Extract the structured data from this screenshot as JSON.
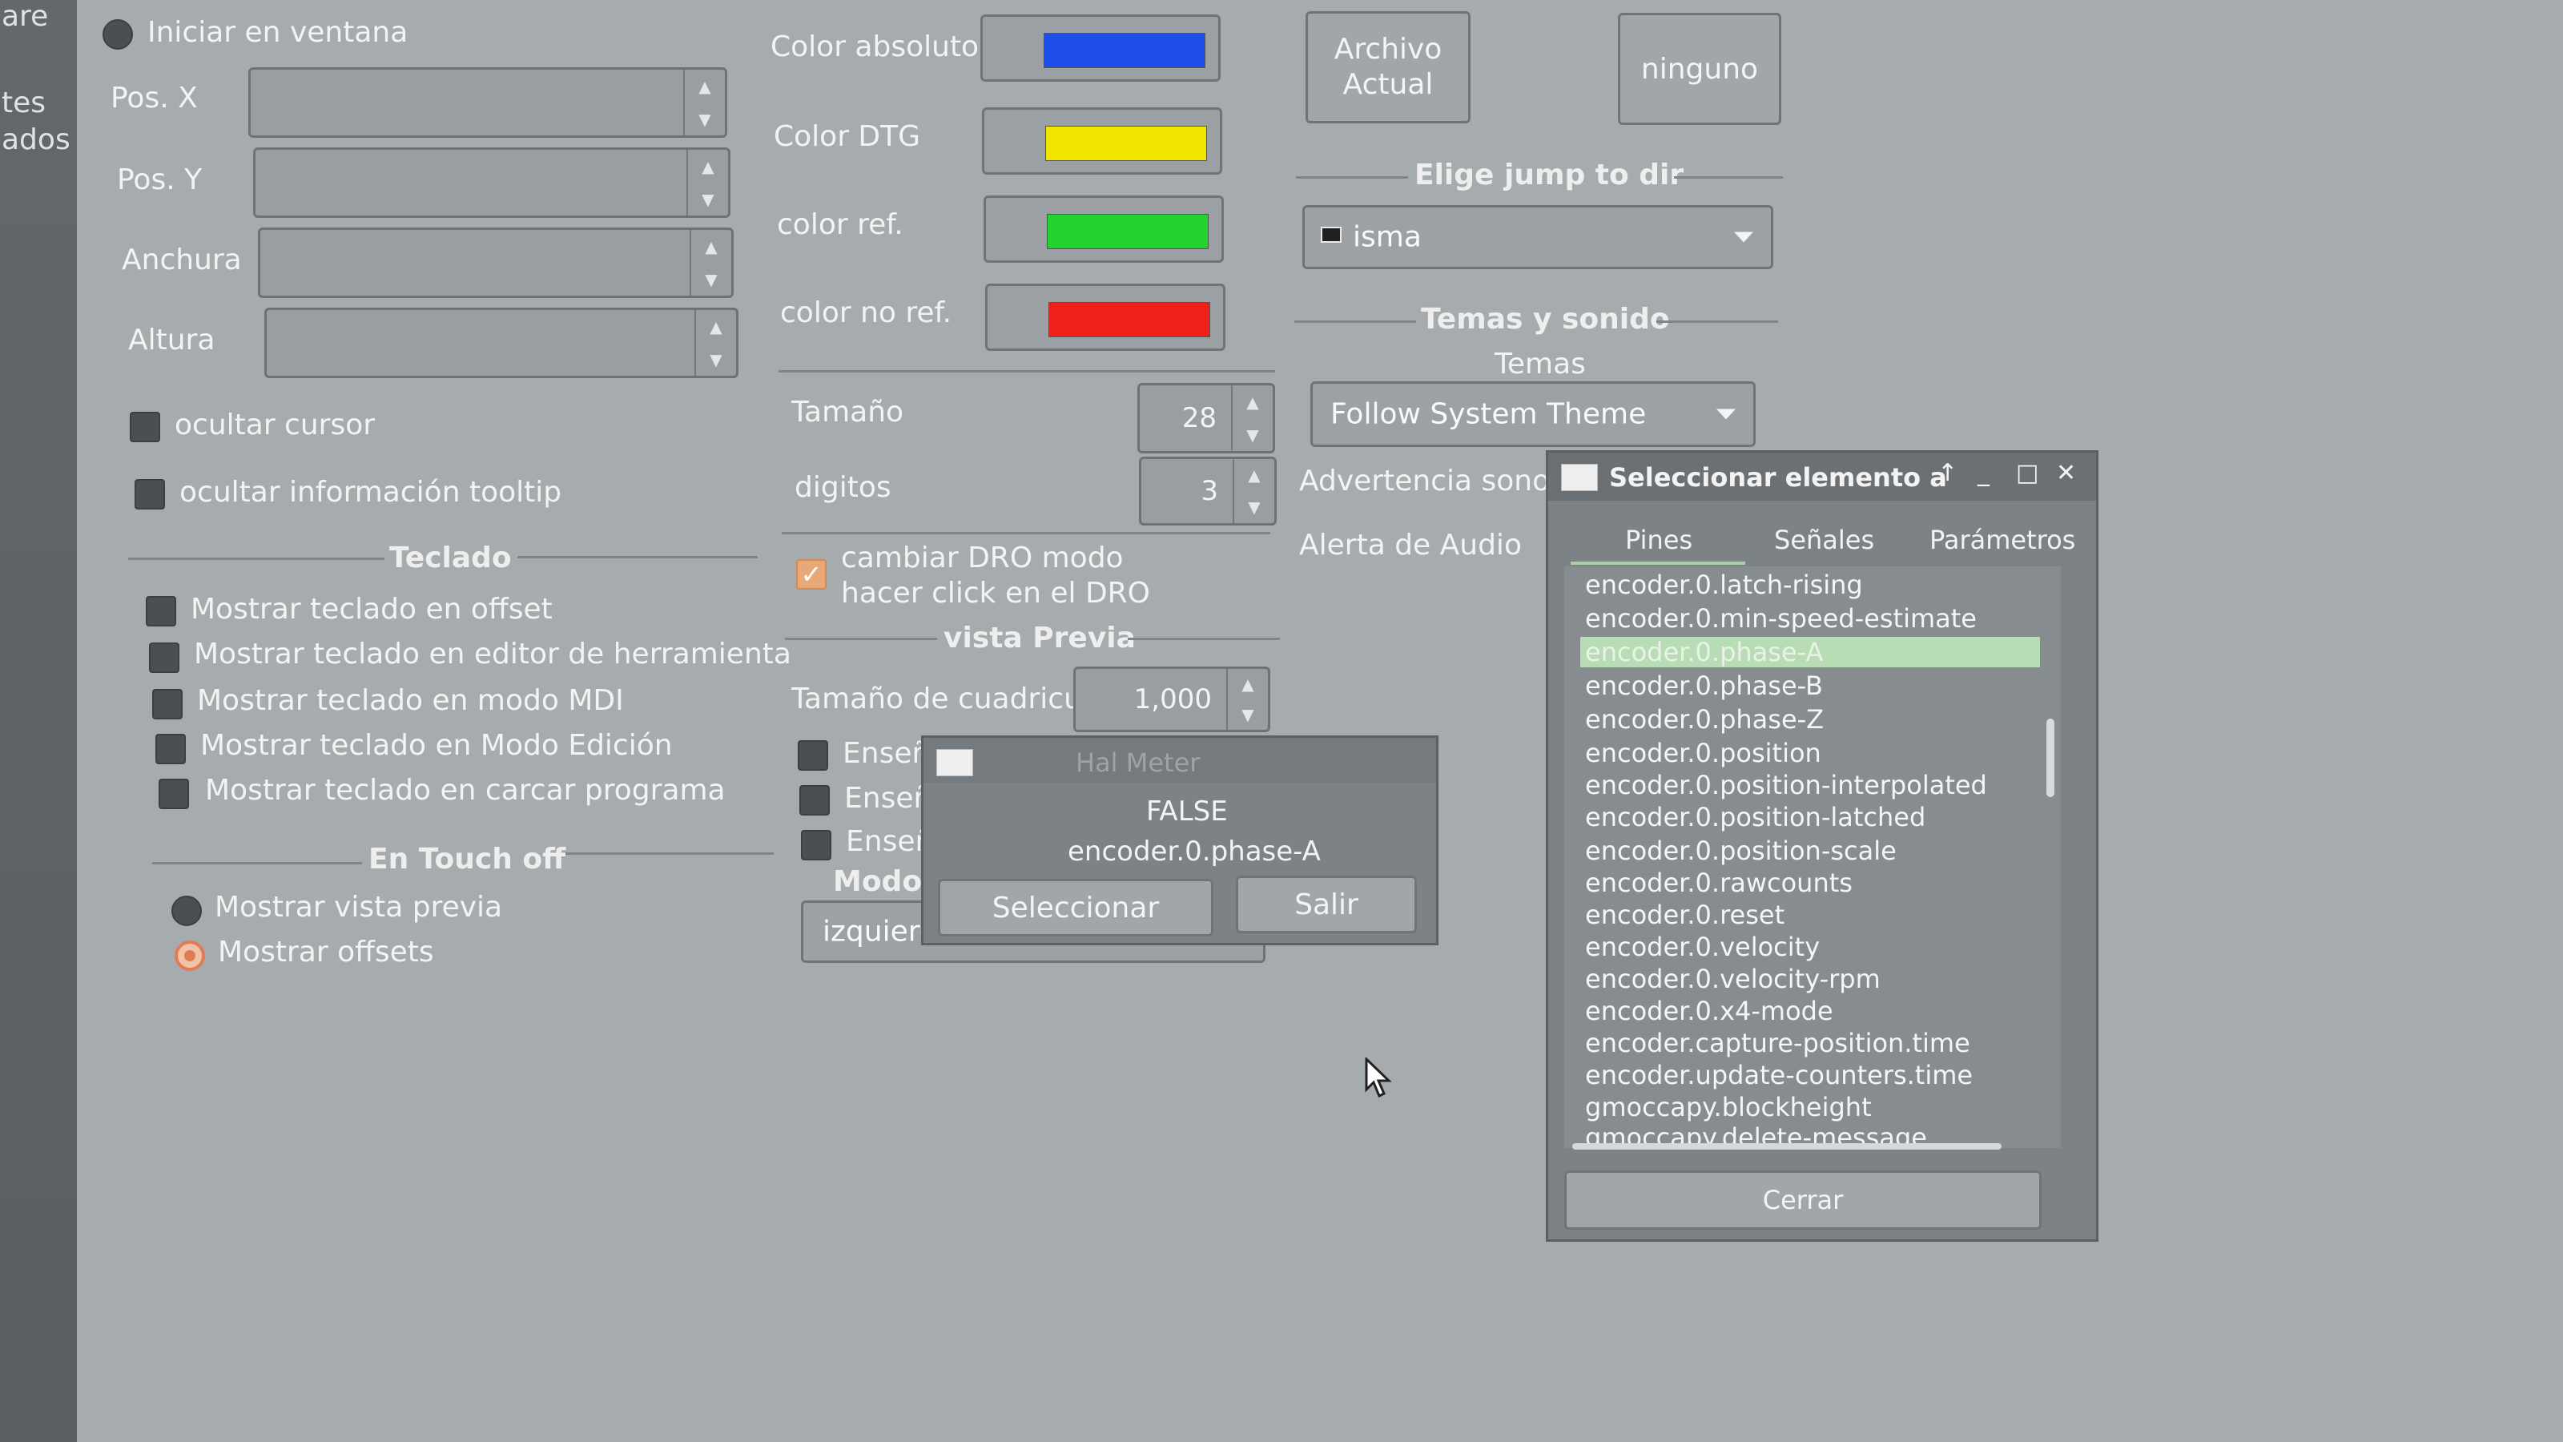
{
  "left_strip": {
    "items": [
      "are",
      "tes",
      "ados"
    ]
  },
  "window_section": {
    "start_in_window_label": "Iniciar en ventana",
    "pos_x_label": "Pos. X",
    "pos_y_label": "Pos. Y",
    "width_label": "Anchura",
    "height_label": "Altura",
    "hide_cursor_label": "ocultar cursor",
    "hide_tooltip_label": "ocultar información tooltip"
  },
  "keyboard_section": {
    "title": "Teclado",
    "options": [
      "Mostrar teclado en offset",
      "Mostrar teclado en editor de herramienta",
      "Mostrar teclado en modo MDI",
      "Mostrar teclado en Modo Edición",
      "Mostrar teclado en carcar programa"
    ]
  },
  "touch_off_section": {
    "title": "En Touch off",
    "options": [
      "Mostrar vista previa",
      "Mostrar offsets"
    ],
    "selected": "Mostrar offsets"
  },
  "dro_colors": {
    "rows": [
      {
        "label": "Color absoluto",
        "color": "#1d4fe8"
      },
      {
        "label": "Color DTG",
        "color": "#f2e600"
      },
      {
        "label": "color ref.",
        "color": "#22d22e"
      },
      {
        "label": "color no ref.",
        "color": "#f0201b"
      }
    ]
  },
  "dro_settings": {
    "size_label": "Tamaño",
    "size_value": "28",
    "digits_label": "digitos",
    "digits_value": "3",
    "change_dro_mode_label_1": "cambiar DRO modo",
    "change_dro_mode_label_2": "hacer click en el DRO"
  },
  "preview_section": {
    "title": "vista Previa",
    "grid_size_label": "Tamaño de cuadricula",
    "grid_size_value": "1,000",
    "show_labels": [
      "Enseñ",
      "Enseñ",
      "Enseñ"
    ],
    "mode_label": "Modo",
    "mode_value": "izquierc"
  },
  "file_section": {
    "current_file_label_1": "Archivo",
    "current_file_label_2": "Actual",
    "file_value": "ninguno",
    "jump_dir_title": "Elige jump to dir",
    "jump_dir_value": "isma"
  },
  "themes_section": {
    "title": "Temas y sonido",
    "themes_label": "Temas",
    "theme_value": "Follow System Theme",
    "sound_warning_label": "Advertencia sonora",
    "audio_alert_label": "Alerta de Audio"
  },
  "hal_meter": {
    "title": "Hal Meter",
    "value": "FALSE",
    "pin": "encoder.0.phase-A",
    "select_label": "Seleccionar",
    "exit_label": "Salir"
  },
  "select_dialog": {
    "title": "Seleccionar elemento a",
    "tabs": [
      "Pines",
      "Señales",
      "Parámetros"
    ],
    "active_tab": "Pines",
    "items": [
      "encoder.0.latch-rising",
      "encoder.0.min-speed-estimate",
      "encoder.0.phase-A",
      "encoder.0.phase-B",
      "encoder.0.phase-Z",
      "encoder.0.position",
      "encoder.0.position-interpolated",
      "encoder.0.position-latched",
      "encoder.0.position-scale",
      "encoder.0.rawcounts",
      "encoder.0.reset",
      "encoder.0.velocity",
      "encoder.0.velocity-rpm",
      "encoder.0.x4-mode",
      "encoder.capture-position.time",
      "encoder.update-counters.time",
      "gmoccapy.blockheight",
      "gmoccapy.delete-message"
    ],
    "selected_item": "encoder.0.phase-A",
    "close_label": "Cerrar"
  }
}
